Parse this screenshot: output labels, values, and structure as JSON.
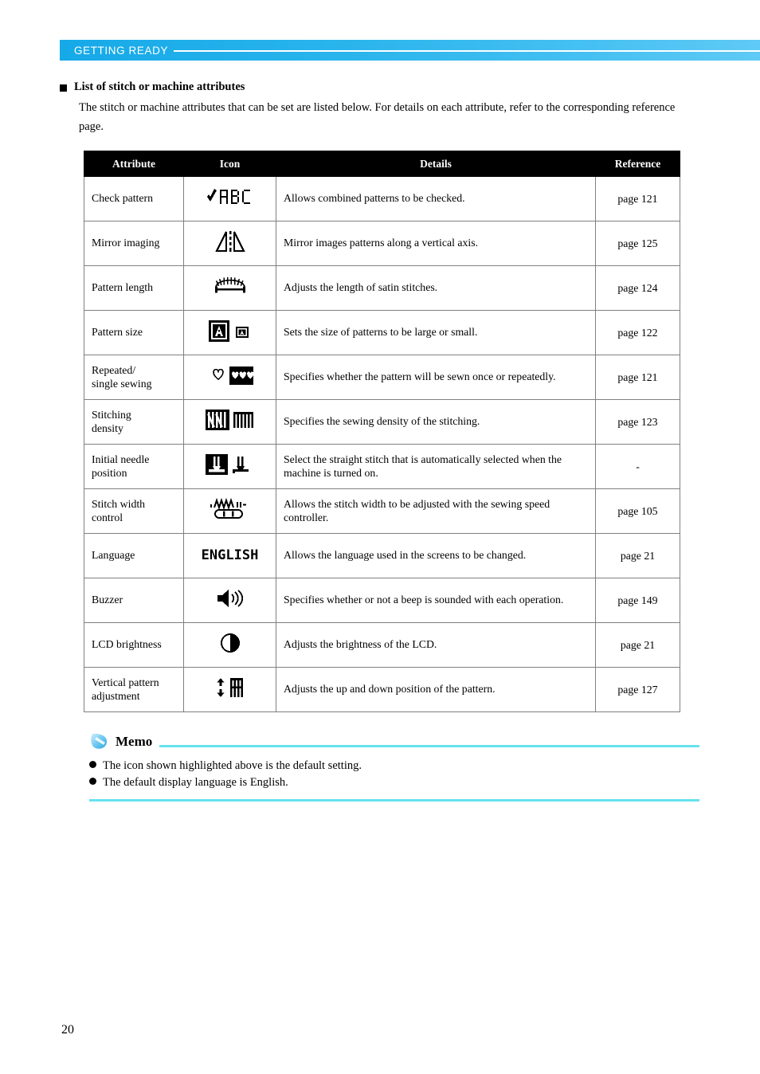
{
  "header": {
    "title": "GETTING READY"
  },
  "section": {
    "heading": "List of stitch or machine attributes",
    "body": "The stitch or machine attributes that can be set are listed below. For details on each attribute, refer to the corresponding reference page."
  },
  "table": {
    "columns": [
      "Attribute",
      "Icon",
      "Details",
      "Reference"
    ],
    "rows": [
      {
        "attribute": "Check pattern",
        "icon_name": "check-abc-icon",
        "details": "Allows combined patterns to be checked.",
        "reference": "page 121"
      },
      {
        "attribute": "Mirror imaging",
        "icon_name": "mirror-imaging-icon",
        "details": "Mirror images patterns along a vertical axis.",
        "reference": "page 125"
      },
      {
        "attribute": "Pattern length",
        "icon_name": "pattern-length-icon",
        "details": "Adjusts the length of satin stitches.",
        "reference": "page 124"
      },
      {
        "attribute": "Pattern size",
        "icon_name": "pattern-size-icon",
        "details": "Sets the size of patterns to be large or small.",
        "reference": "page 122"
      },
      {
        "attribute": "Repeated/\nsingle sewing",
        "icon_name": "repeated-single-sewing-icon",
        "details": "Specifies whether the pattern will be sewn once or repeatedly.",
        "reference": "page 121"
      },
      {
        "attribute": "Stitching\ndensity",
        "icon_name": "stitching-density-icon",
        "details": "Specifies the sewing density of the stitching.",
        "reference": "page 123"
      },
      {
        "attribute": "Initial needle\nposition",
        "icon_name": "initial-needle-position-icon",
        "details": "Select the straight stitch that is automatically selected when the machine is turned on.",
        "reference": "-"
      },
      {
        "attribute": "Stitch width\ncontrol",
        "icon_name": "stitch-width-control-icon",
        "details": "Allows the stitch width to be adjusted with the sewing speed controller.",
        "reference": "page 105"
      },
      {
        "attribute": "Language",
        "icon_name": "language-english-icon",
        "icon_text": "ENGLISH",
        "details": "Allows the language used in the screens to be changed.",
        "reference": "page 21"
      },
      {
        "attribute": "Buzzer",
        "icon_name": "buzzer-speaker-icon",
        "details": "Specifies whether or not a beep is sounded with each operation.",
        "reference": "page 149"
      },
      {
        "attribute": "LCD brightness",
        "icon_name": "lcd-brightness-icon",
        "details": "Adjusts the brightness of the LCD.",
        "reference": "page 21"
      },
      {
        "attribute": "Vertical pattern\nadjustment",
        "icon_name": "vertical-pattern-adjustment-icon",
        "details": "Adjusts the up and down position of the pattern.",
        "reference": "page 127"
      }
    ]
  },
  "memo": {
    "title": "Memo",
    "items": [
      "The icon shown highlighted above is the default setting.",
      "The default display language is English."
    ]
  },
  "footer": {
    "page_number": "20"
  },
  "colors": {
    "header_band_left": "#16a9e8",
    "header_band_right": "#5fcaf5",
    "memo_rule": "#66e3ee",
    "table_header_bg": "#000000",
    "table_border": "#808080"
  }
}
